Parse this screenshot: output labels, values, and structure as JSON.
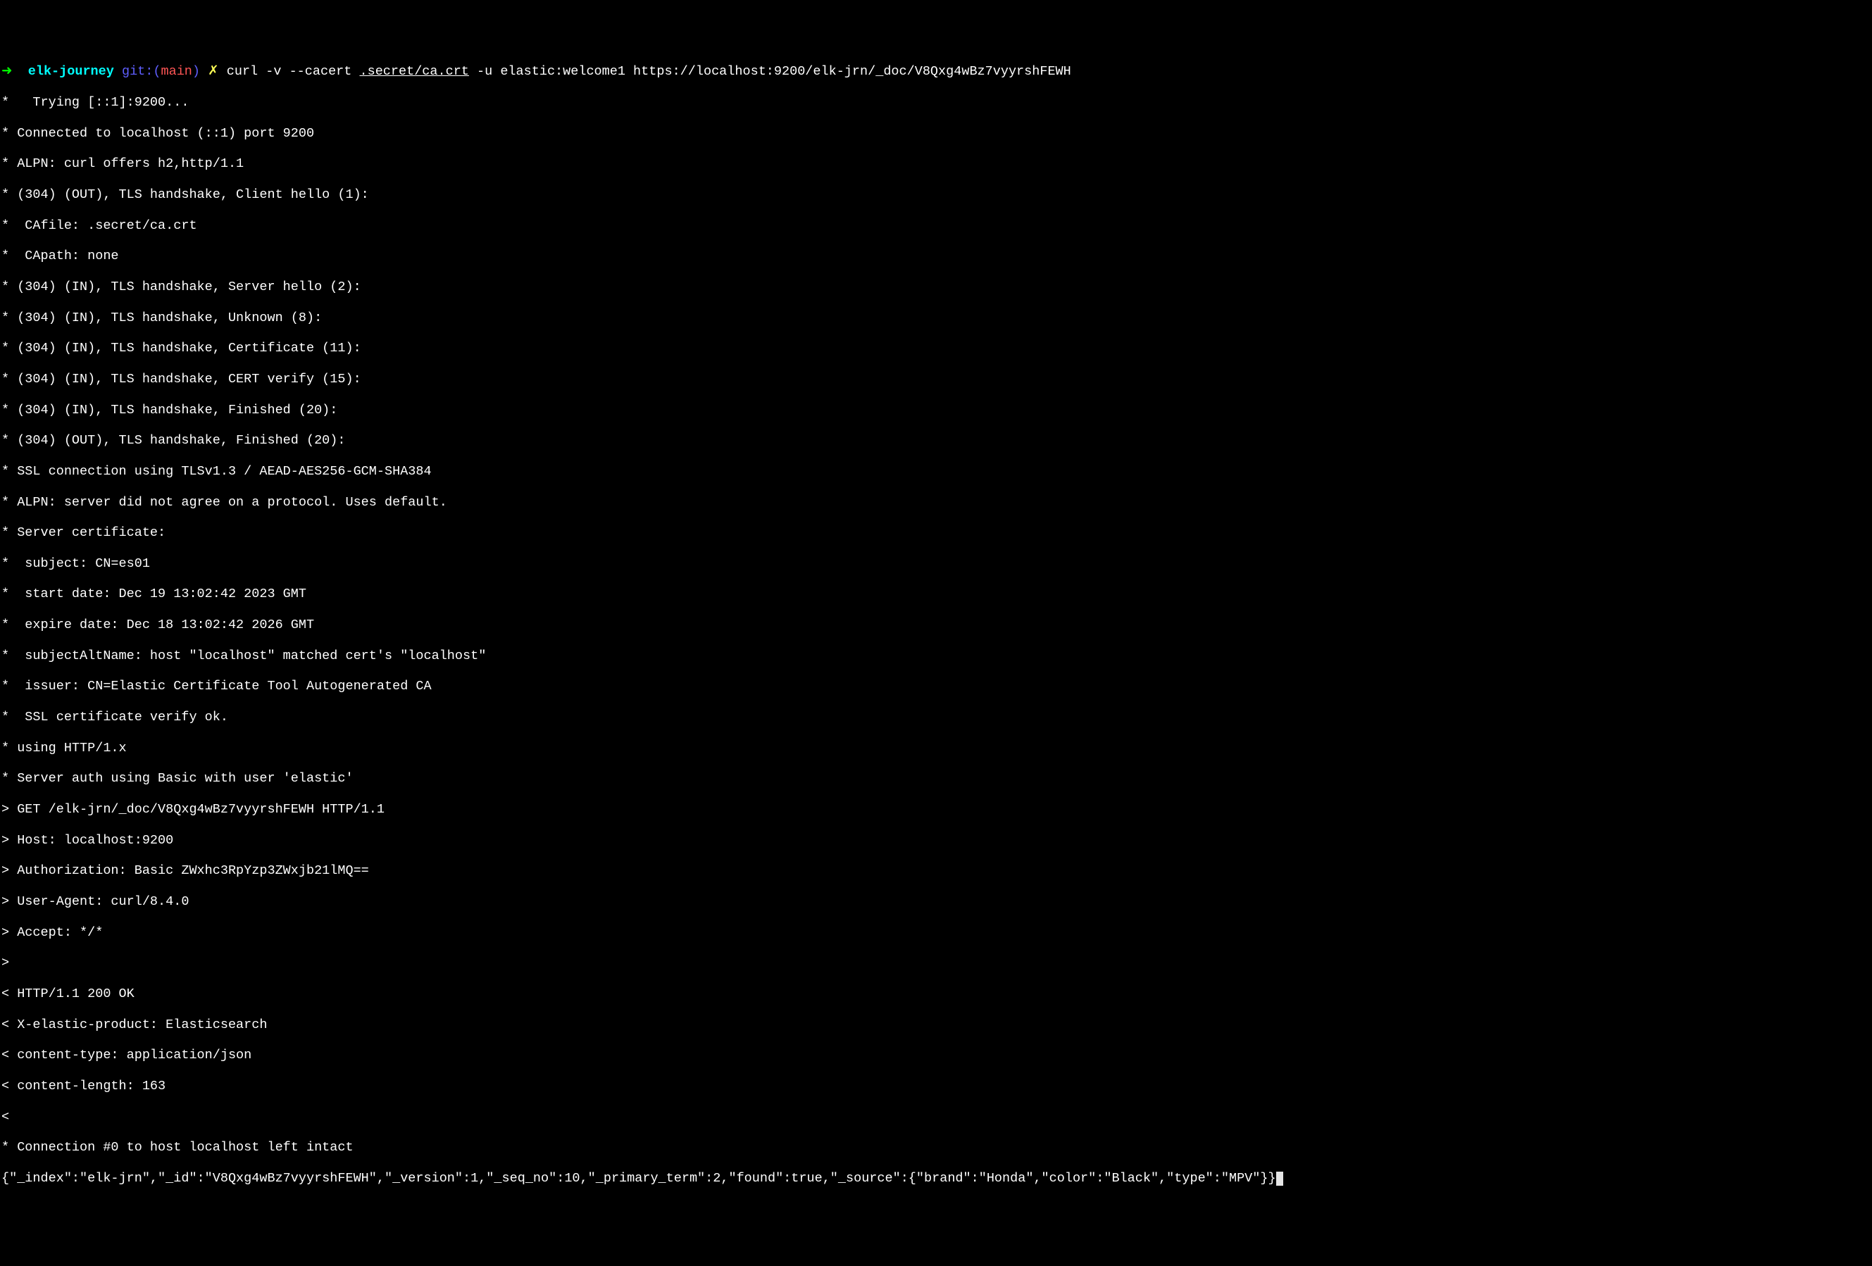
{
  "prompt": {
    "arrow": "➜",
    "dir": "elk-journey",
    "git_prefix": "git:(",
    "branch": "main",
    "git_suffix": ")",
    "x": "✗",
    "cmd_prefix": "curl -v --cacert ",
    "cacert_path": ".secret/ca.crt",
    "cmd_suffix": " -u elastic:welcome1 https://localhost:9200/elk-jrn/_doc/V8Qxg4wBz7vyyrshFEWH"
  },
  "lines": {
    "l0": "*   Trying [::1]:9200...",
    "l1": "* Connected to localhost (::1) port 9200",
    "l2": "* ALPN: curl offers h2,http/1.1",
    "l3": "* (304) (OUT), TLS handshake, Client hello (1):",
    "l4": "*  CAfile: .secret/ca.crt",
    "l5": "*  CApath: none",
    "l6": "* (304) (IN), TLS handshake, Server hello (2):",
    "l7": "* (304) (IN), TLS handshake, Unknown (8):",
    "l8": "* (304) (IN), TLS handshake, Certificate (11):",
    "l9": "* (304) (IN), TLS handshake, CERT verify (15):",
    "l10": "* (304) (IN), TLS handshake, Finished (20):",
    "l11": "* (304) (OUT), TLS handshake, Finished (20):",
    "l12": "* SSL connection using TLSv1.3 / AEAD-AES256-GCM-SHA384",
    "l13": "* ALPN: server did not agree on a protocol. Uses default.",
    "l14": "* Server certificate:",
    "l15": "*  subject: CN=es01",
    "l16": "*  start date: Dec 19 13:02:42 2023 GMT",
    "l17": "*  expire date: Dec 18 13:02:42 2026 GMT",
    "l18": "*  subjectAltName: host \"localhost\" matched cert's \"localhost\"",
    "l19": "*  issuer: CN=Elastic Certificate Tool Autogenerated CA",
    "l20": "*  SSL certificate verify ok.",
    "l21": "* using HTTP/1.x",
    "l22": "* Server auth using Basic with user 'elastic'",
    "l23": "> GET /elk-jrn/_doc/V8Qxg4wBz7vyyrshFEWH HTTP/1.1",
    "l24": "> Host: localhost:9200",
    "l25": "> Authorization: Basic ZWxhc3RpYzp3ZWxjb21lMQ==",
    "l26": "> User-Agent: curl/8.4.0",
    "l27": "> Accept: */*",
    "l28": ">",
    "l29": "< HTTP/1.1 200 OK",
    "l30": "< X-elastic-product: Elasticsearch",
    "l31": "< content-type: application/json",
    "l32": "< content-length: 163",
    "l33": "<",
    "l34": "* Connection #0 to host localhost left intact",
    "l35": "{\"_index\":\"elk-jrn\",\"_id\":\"V8Qxg4wBz7vyyrshFEWH\",\"_version\":1,\"_seq_no\":10,\"_primary_term\":2,\"found\":true,\"_source\":{\"brand\":\"Honda\",\"color\":\"Black\",\"type\":\"MPV\"}}"
  }
}
